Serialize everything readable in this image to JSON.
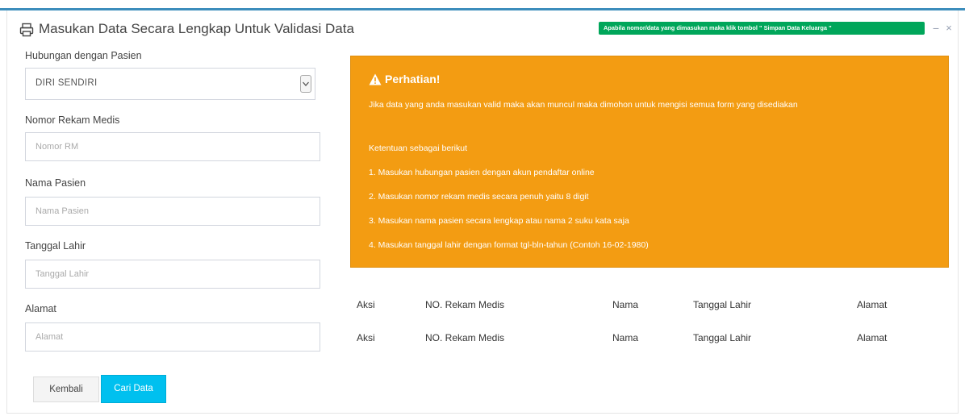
{
  "modal": {
    "title": "Masukan Data Secara Lengkap Untuk Validasi Data",
    "icon": "print-icon",
    "note_badge": "Apabila nomor/data yang dimasukan maka klik tombol \" Simpan Data Keluarga \"",
    "minimize_label": "−",
    "close_label": "×"
  },
  "form": {
    "relationship": {
      "label": "Hubungan dengan Pasien",
      "selected": "DIRI SENDIRI"
    },
    "medical_record": {
      "label": "Nomor Rekam Medis",
      "placeholder": "Nomor RM"
    },
    "patient_name": {
      "label": "Nama Pasien",
      "placeholder": "Nama Pasien"
    },
    "birth_date": {
      "label": "Tanggal Lahir",
      "placeholder": "Tanggal Lahir"
    },
    "address": {
      "label": "Alamat",
      "placeholder": "Alamat"
    }
  },
  "buttons": {
    "back": "Kembali",
    "search": "Cari Data"
  },
  "alert": {
    "title": "Perhatian!",
    "icon": "warning-icon",
    "color": "#f39c12",
    "intro": "Jika data yang anda masukan valid maka akan muncul maka dimohon untuk mengisi semua form yang disediakan",
    "subtitle": "Ketentuan sebagai berikut",
    "rules": [
      "1. Masukan hubungan pasien dengan akun pendaftar online",
      "2. Masukan nomor rekam medis secara penuh yaitu 8 digit",
      "3. Masukan nama pasien secara lengkap atau nama 2 suku kata saja",
      "4. Masukan tanggal lahir dengan format tgl-bln-tahun (Contoh 16-02-1980)"
    ]
  },
  "table": {
    "headers": [
      "Aksi",
      "NO. Rekam Medis",
      "Nama",
      "Tanggal Lahir",
      "Alamat"
    ],
    "footers": [
      "Aksi",
      "NO. Rekam Medis",
      "Nama",
      "Tanggal Lahir",
      "Alamat"
    ]
  },
  "colors": {
    "accent": "#3c8dbc",
    "badge": "#00a65a",
    "search_button": "#00c0ef",
    "alert": "#f39c12"
  }
}
